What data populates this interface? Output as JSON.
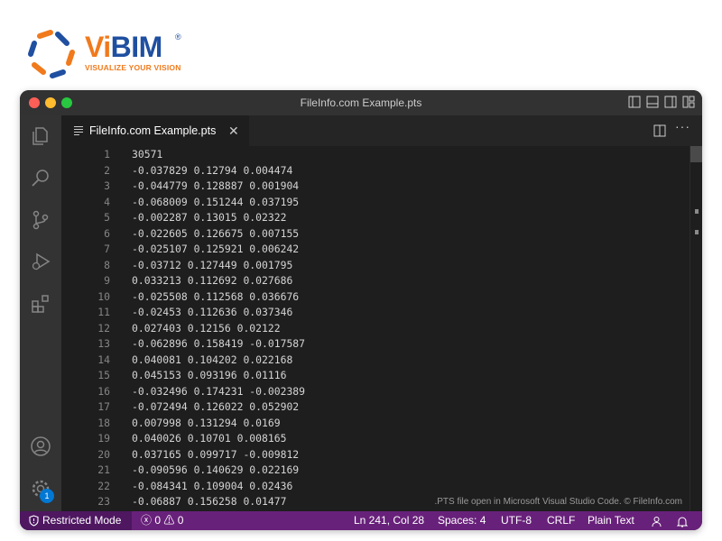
{
  "logo": {
    "brand_vi": "Vi",
    "brand_bim": "BIM",
    "registered": "®",
    "tagline": "VISUALIZE YOUR VISION"
  },
  "window": {
    "title": "FileInfo.com Example.pts",
    "tab_label": "FileInfo.com Example.pts",
    "close_glyph": "✕",
    "more_glyph": "···"
  },
  "editor": {
    "lines": [
      {
        "n": "1",
        "text": "30571"
      },
      {
        "n": "2",
        "text": "-0.037829 0.12794 0.004474"
      },
      {
        "n": "3",
        "text": "-0.044779 0.128887 0.001904"
      },
      {
        "n": "4",
        "text": "-0.068009 0.151244 0.037195"
      },
      {
        "n": "5",
        "text": "-0.002287 0.13015 0.02322"
      },
      {
        "n": "6",
        "text": "-0.022605 0.126675 0.007155"
      },
      {
        "n": "7",
        "text": "-0.025107 0.125921 0.006242"
      },
      {
        "n": "8",
        "text": "-0.03712 0.127449 0.001795"
      },
      {
        "n": "9",
        "text": "0.033213 0.112692 0.027686"
      },
      {
        "n": "10",
        "text": "-0.025508 0.112568 0.036676"
      },
      {
        "n": "11",
        "text": "-0.02453 0.112636 0.037346"
      },
      {
        "n": "12",
        "text": "0.027403 0.12156 0.02122"
      },
      {
        "n": "13",
        "text": "-0.062896 0.158419 -0.017587"
      },
      {
        "n": "14",
        "text": "0.040081 0.104202 0.022168"
      },
      {
        "n": "15",
        "text": "0.045153 0.093196 0.01116"
      },
      {
        "n": "16",
        "text": "-0.032496 0.174231 -0.002389"
      },
      {
        "n": "17",
        "text": "-0.072494 0.126022 0.052902"
      },
      {
        "n": "18",
        "text": "0.007998 0.131294 0.0169"
      },
      {
        "n": "19",
        "text": "0.040026 0.10701 0.008165"
      },
      {
        "n": "20",
        "text": "0.037165 0.099717 -0.009812"
      },
      {
        "n": "21",
        "text": "-0.090596 0.140629 0.022169"
      },
      {
        "n": "22",
        "text": "-0.084341 0.109004 0.02436"
      },
      {
        "n": "23",
        "text": "-0.06887 0.156258 0.01477"
      }
    ],
    "watermark": ".PTS file open in Microsoft Visual Studio Code. © FileInfo.com"
  },
  "activity": {
    "accounts_badge": "1"
  },
  "status": {
    "restricted": "Restricted Mode",
    "errors": "0",
    "warnings": "0",
    "position": "Ln 241, Col 28",
    "spaces": "Spaces: 4",
    "encoding": "UTF-8",
    "eol": "CRLF",
    "language": "Plain Text"
  },
  "colors": {
    "status_bar": "#68217a",
    "restricted_bg": "#4e1760",
    "editor_bg": "#1e1e1e",
    "activity_bar": "#333333",
    "logo_orange": "#f07a1c",
    "logo_blue": "#1f4fa0"
  },
  "icons": [
    "explorer-icon",
    "search-icon",
    "source-control-icon",
    "run-debug-icon",
    "extensions-icon",
    "account-icon",
    "settings-gear-icon",
    "shield-icon",
    "error-icon",
    "warning-icon",
    "feedback-icon",
    "bell-icon",
    "split-editor-icon",
    "more-actions-icon",
    "file-lines-icon"
  ]
}
